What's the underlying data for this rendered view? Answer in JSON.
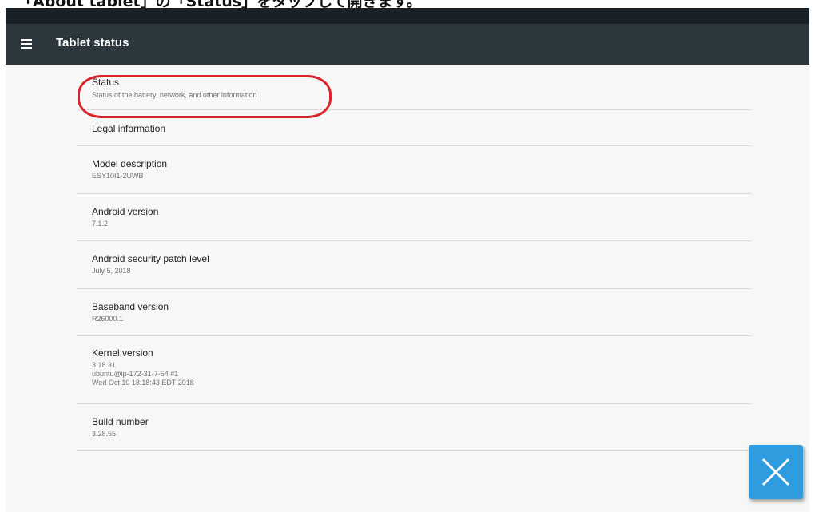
{
  "caption": "「About tablet」の「Status」をタップして開きます。",
  "toolbar": {
    "menu_icon": "menu-icon",
    "title": "Tablet status"
  },
  "items": [
    {
      "title": "Status",
      "summary": "Status of the battery, network, and other information"
    },
    {
      "title": "Legal information",
      "summary": ""
    },
    {
      "title": "Model description",
      "summary": "ESY10I1-2UWB"
    },
    {
      "title": "Android version",
      "summary": "7.1.2"
    },
    {
      "title": "Android security patch level",
      "summary": "July 5, 2018"
    },
    {
      "title": "Baseband version",
      "summary": "R26000.1"
    },
    {
      "title": "Kernel version",
      "summary": "3.18.31\nubuntu@ip-172-31-7-54 #1\nWed Oct 10 18:18:43 EDT 2018"
    },
    {
      "title": "Build number",
      "summary": "3.28.55"
    }
  ],
  "overlay": {
    "highlight_color": "#d9242a",
    "close_icon": "close-icon",
    "close_button_color": "#2f9ce0"
  }
}
